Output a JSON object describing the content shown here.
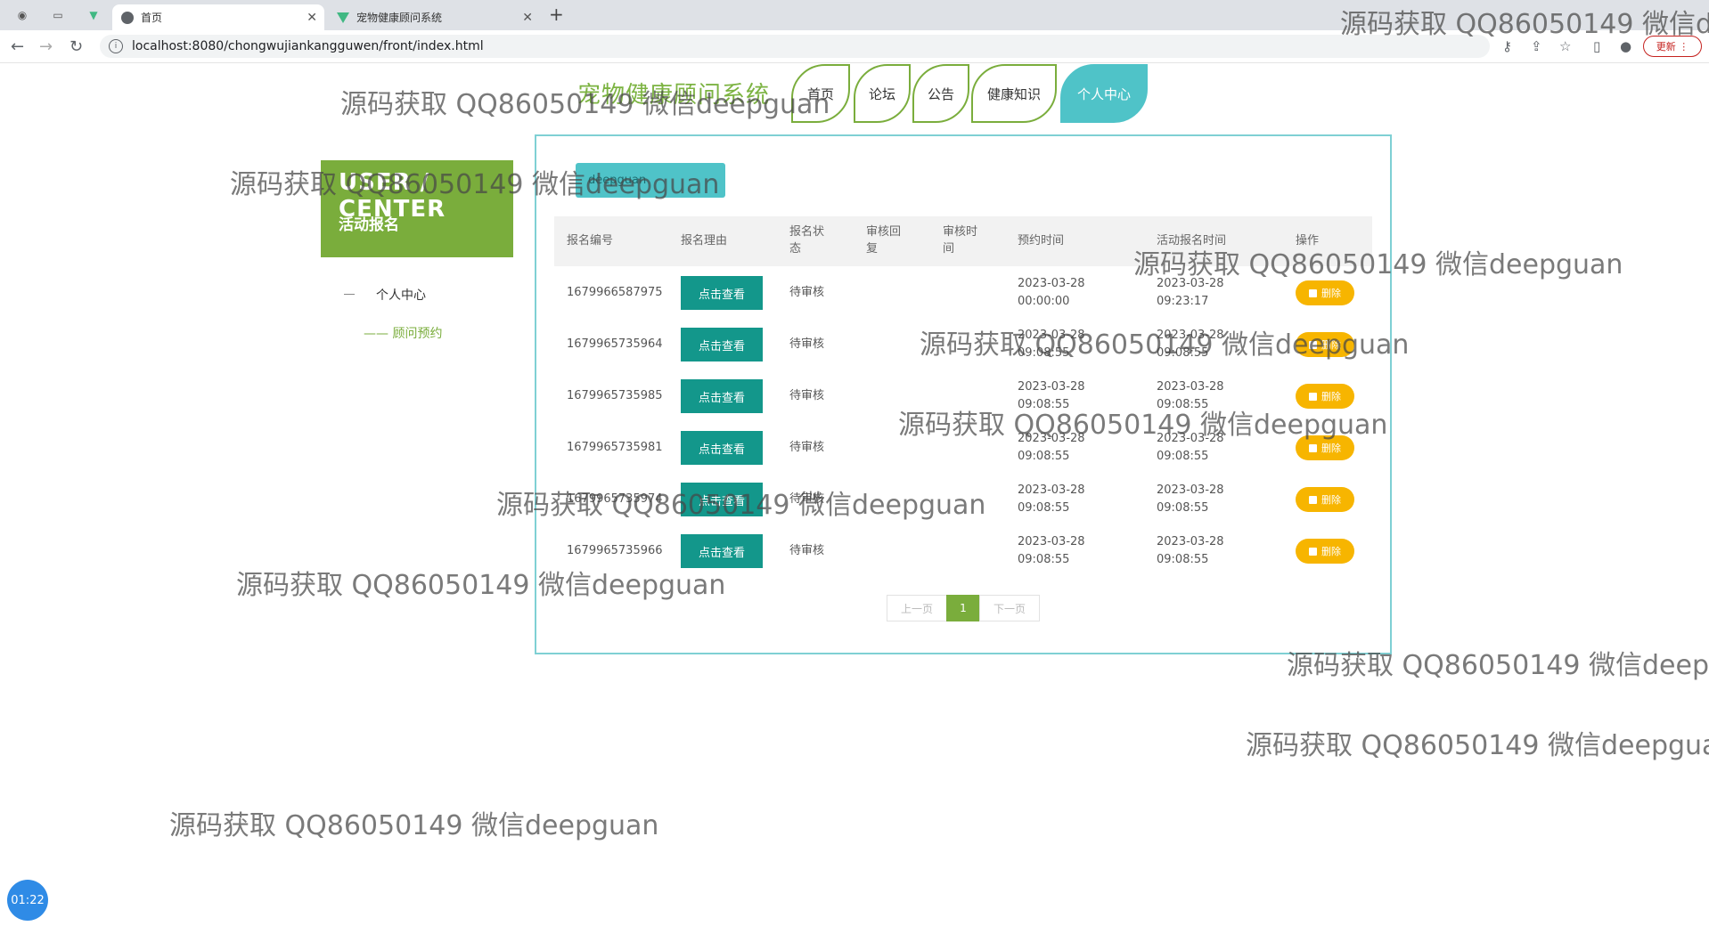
{
  "browser": {
    "tabs": [
      {
        "label": "首页"
      },
      {
        "label": "宠物健康顾问系统"
      }
    ],
    "url": "localhost:8080/chongwujiankangguwen/front/index.html",
    "update_label": "更新"
  },
  "site": {
    "title": "宠物健康顾问系统",
    "nav": [
      "首页",
      "论坛",
      "公告",
      "健康知识",
      "个人中心"
    ]
  },
  "sidebar": {
    "heading": "USER / CENTER",
    "subheading": "活动报名",
    "items": [
      "个人中心",
      "顾问预约"
    ]
  },
  "panel": {
    "user_badge": "deepguan",
    "columns": [
      "报名编号",
      "报名理由",
      "报名状态",
      "审核回复",
      "审核时间",
      "预约时间",
      "活动报名时间",
      "操作"
    ],
    "view_label": "点击查看",
    "delete_label": "删除",
    "rows": [
      {
        "id": "1679966587975",
        "status": "待审核",
        "reply": "",
        "audit_time": "",
        "appt_date": "2023-03-28",
        "appt_time": "00:00:00",
        "reg_date": "2023-03-28",
        "reg_time": "09:23:17"
      },
      {
        "id": "1679965735964",
        "status": "待审核",
        "reply": "",
        "audit_time": "",
        "appt_date": "2023-03-28",
        "appt_time": "09:08:55",
        "reg_date": "2023-03-28",
        "reg_time": "09:08:55"
      },
      {
        "id": "1679965735985",
        "status": "待审核",
        "reply": "",
        "audit_time": "",
        "appt_date": "2023-03-28",
        "appt_time": "09:08:55",
        "reg_date": "2023-03-28",
        "reg_time": "09:08:55"
      },
      {
        "id": "1679965735981",
        "status": "待审核",
        "reply": "",
        "audit_time": "",
        "appt_date": "2023-03-28",
        "appt_time": "09:08:55",
        "reg_date": "2023-03-28",
        "reg_time": "09:08:55"
      },
      {
        "id": "1679965735974",
        "status": "待审核",
        "reply": "",
        "audit_time": "",
        "appt_date": "2023-03-28",
        "appt_time": "09:08:55",
        "reg_date": "2023-03-28",
        "reg_time": "09:08:55"
      },
      {
        "id": "1679965735966",
        "status": "待审核",
        "reply": "",
        "audit_time": "",
        "appt_date": "2023-03-28",
        "appt_time": "09:08:55",
        "reg_date": "2023-03-28",
        "reg_time": "09:08:55"
      }
    ],
    "pagination": {
      "prev": "上一页",
      "current": "1",
      "next": "下一页"
    }
  },
  "watermark": "源码获取 QQ86050149 微信deepguan",
  "timer": "01:22",
  "colors": {
    "brand_green": "#7aad3c",
    "teal": "#4fc3c8",
    "view_button": "#13978b",
    "delete_button": "#f7b500"
  }
}
